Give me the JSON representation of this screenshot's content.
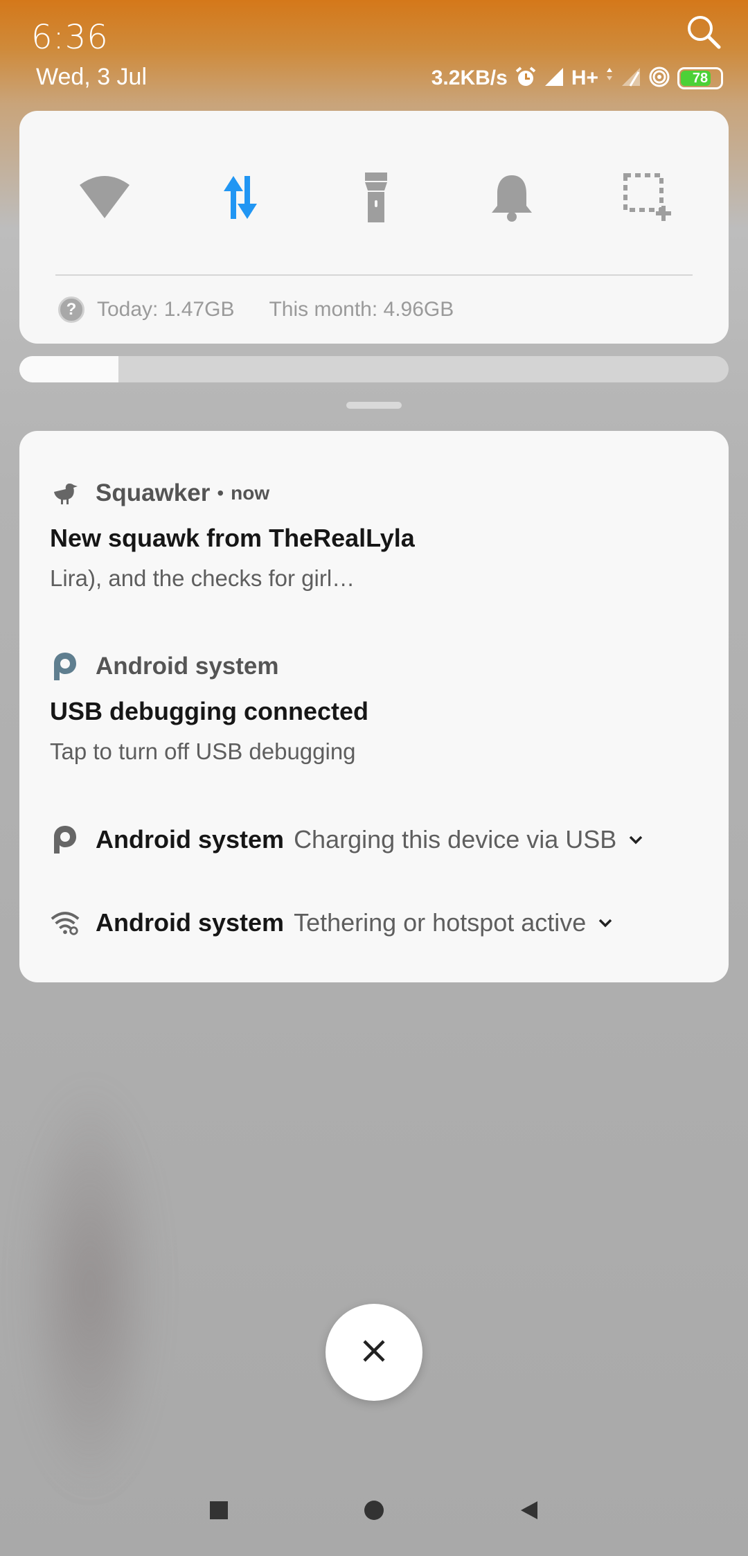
{
  "status_bar": {
    "time": "6:36",
    "date": "Wed, 3 Jul",
    "net_speed": "3.2KB/s",
    "network_type": "H+",
    "battery_level": "78",
    "battery_fraction": 0.78,
    "icons": [
      "search-icon",
      "alarm-icon",
      "signal-icon",
      "data-arrows-icon",
      "no-signal-icon",
      "hotspot-icon",
      "battery-icon"
    ]
  },
  "quick_settings": {
    "tiles": [
      {
        "name": "wifi",
        "icon": "wifi-icon",
        "active": false
      },
      {
        "name": "mobile-data",
        "icon": "data-transfer-icon",
        "active": true
      },
      {
        "name": "flashlight",
        "icon": "flashlight-icon",
        "active": false
      },
      {
        "name": "sound",
        "icon": "bell-icon",
        "active": false
      },
      {
        "name": "screenshot",
        "icon": "screenshot-crop-icon",
        "active": false
      }
    ],
    "data_usage": {
      "today": "Today: 1.47GB",
      "month": "This month: 4.96GB"
    },
    "brightness_fraction": 0.14,
    "active_color": "#2196f3"
  },
  "notifications": [
    {
      "app": "Squawker",
      "separator": "•",
      "time": "now",
      "title": "New squawk from TheRealLyla",
      "text": "Lira), and the checks for girl…",
      "icon": "bird-icon"
    },
    {
      "app": "Android system",
      "title": "USB debugging connected",
      "text": "Tap to turn off USB debugging",
      "icon": "android-p-icon"
    },
    {
      "app": "Android system",
      "summary": "Charging this device via USB",
      "icon": "android-p-icon"
    },
    {
      "app": "Android system",
      "summary": "Tethering or hotspot active",
      "icon": "wifi-tethering-icon"
    }
  ],
  "close_button": {
    "icon": "close-icon"
  },
  "nav_bar": {
    "icons": [
      "recents-icon",
      "home-icon",
      "back-icon"
    ]
  }
}
